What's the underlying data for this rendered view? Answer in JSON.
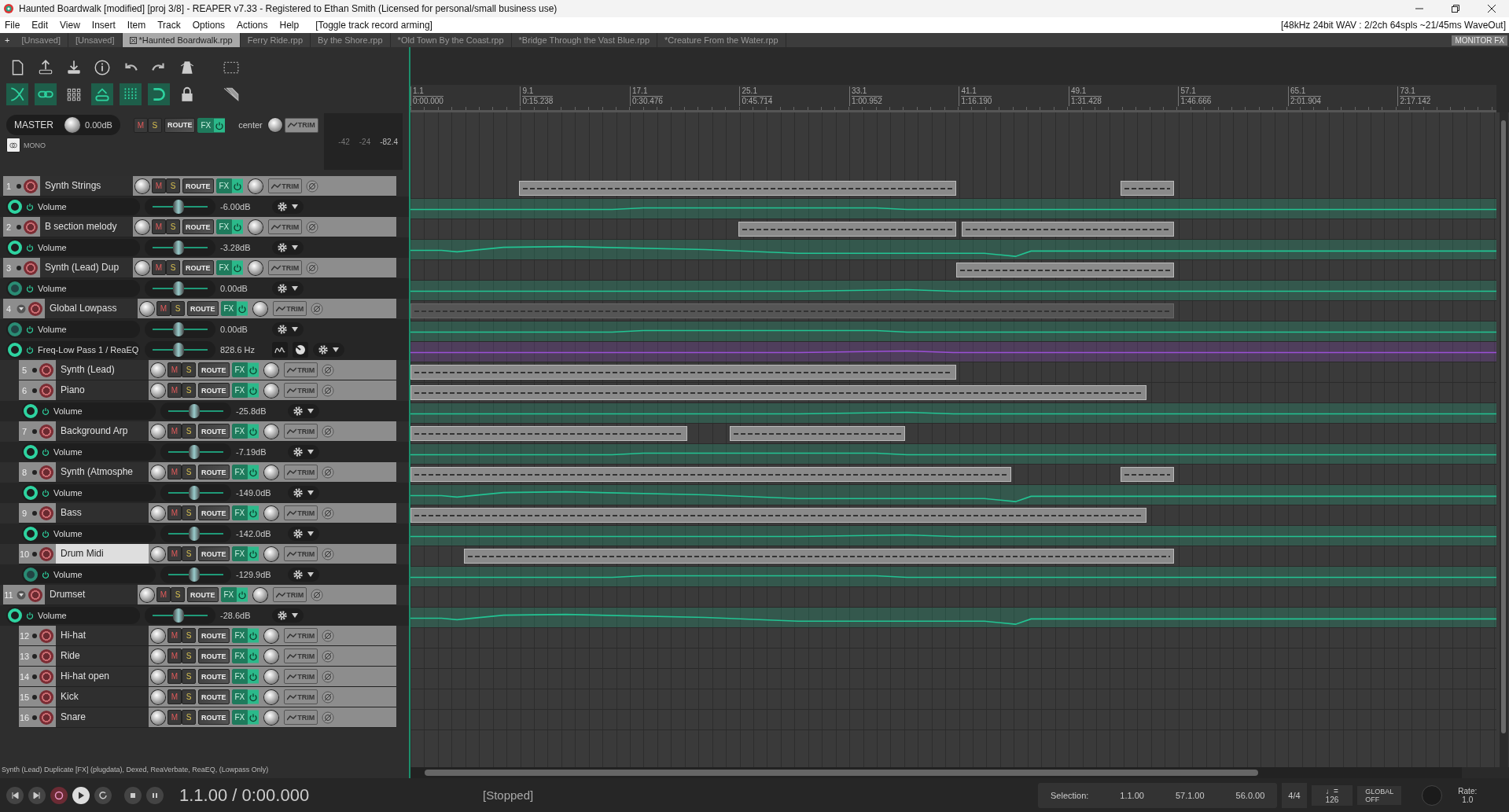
{
  "window": {
    "title": "Haunted Boardwalk [modified] [proj 3/8] - REAPER v7.33 - Registered to Ethan Smith (Licensed for personal/small business use)"
  },
  "menu": [
    "File",
    "Edit",
    "View",
    "Insert",
    "Item",
    "Track",
    "Options",
    "Actions",
    "Help"
  ],
  "menu_hint": "[Toggle track record arming]",
  "audio_status": "[48kHz 24bit WAV : 2/2ch 64spls ~21/45ms WaveOut]",
  "new_tab": "+",
  "project_tabs": [
    {
      "label": "[Unsaved]",
      "selected": false
    },
    {
      "label": "[Unsaved]",
      "selected": false
    },
    {
      "label": "*Haunted Boardwalk.rpp",
      "selected": true
    },
    {
      "label": "Ferry Ride.rpp",
      "selected": false
    },
    {
      "label": "By the Shore.rpp",
      "selected": false
    },
    {
      "label": "*Old  Town By the Coast.rpp",
      "selected": false
    },
    {
      "label": "*Bridge Through the Vast Blue.rpp",
      "selected": false
    },
    {
      "label": "*Creature From the Water.rpp",
      "selected": false
    }
  ],
  "monitor_fx": "MONITOR FX",
  "master": {
    "label": "MASTER",
    "volume": "0.00dB",
    "mute": "M",
    "solo": "S",
    "route": "ROUTE",
    "fx": "FX",
    "pan": "center",
    "trim": "TRIM",
    "mono": "MONO",
    "meter_ticks": [
      "-42",
      "-24"
    ],
    "peak": "-82.4"
  },
  "ruler": [
    {
      "bar": "1.1",
      "time": "0:00.000"
    },
    {
      "bar": "9.1",
      "time": "0:15.238"
    },
    {
      "bar": "17.1",
      "time": "0:30.476"
    },
    {
      "bar": "25.1",
      "time": "0:45.714"
    },
    {
      "bar": "33.1",
      "time": "1:00.952"
    },
    {
      "bar": "41.1",
      "time": "1:16.190"
    },
    {
      "bar": "49.1",
      "time": "1:31.428"
    },
    {
      "bar": "57.1",
      "time": "1:46.666"
    },
    {
      "bar": "65.1",
      "time": "2:01.904"
    },
    {
      "bar": "73.1",
      "time": "2:17.142"
    }
  ],
  "tracks": [
    {
      "number": "1",
      "name": "Synth Strings",
      "selected": false,
      "mute": "M",
      "solo": "S",
      "route": "ROUTE",
      "fx": "FX",
      "trim": "TRIM",
      "envelopes": [
        {
          "kind": "volume",
          "name": "Volume",
          "value": "-6.00dB",
          "armed": true,
          "color": "#22c493"
        }
      ]
    },
    {
      "number": "2",
      "name": "B section melody",
      "selected": false,
      "mute": "M",
      "solo": "S",
      "route": "ROUTE",
      "fx": "FX",
      "trim": "TRIM",
      "envelopes": [
        {
          "kind": "volume",
          "name": "Volume",
          "value": "-3.28dB",
          "armed": true,
          "color": "#22c493"
        }
      ]
    },
    {
      "number": "3",
      "name": "Synth (Lead) Dup",
      "selected": false,
      "mute": "M",
      "solo": "S",
      "route": "ROUTE",
      "fx": "FX",
      "trim": "TRIM",
      "envelopes": [
        {
          "kind": "volume",
          "name": "Volume",
          "value": "0.00dB",
          "armed": false,
          "color": "#22c493"
        }
      ]
    },
    {
      "number": "4",
      "name": "Global Lowpass",
      "selected": false,
      "mute": "M",
      "solo": "S",
      "route": "ROUTE",
      "fx": "FX",
      "trim": "TRIM",
      "envelopes": [
        {
          "kind": "volume",
          "name": "Volume",
          "value": "0.00dB",
          "armed": false,
          "color": "#22c493"
        },
        {
          "kind": "fx",
          "name": "Freq-Low Pass 1 / ReaEQ",
          "value": "828.6 Hz",
          "armed": true,
          "color": "#9b4fd6"
        }
      ],
      "children": [
        {
          "number": "5",
          "name": "Synth (Lead)",
          "selected": false,
          "mute": "M",
          "solo": "S",
          "route": "ROUTE",
          "fx": "FX",
          "trim": "TRIM"
        },
        {
          "number": "6",
          "name": "Piano",
          "selected": false,
          "mute": "M",
          "solo": "S",
          "route": "ROUTE",
          "fx": "FX",
          "trim": "TRIM",
          "envelopes": [
            {
              "kind": "volume",
              "name": "Volume",
              "value": "-25.8dB",
              "armed": true,
              "color": "#22c493"
            }
          ]
        },
        {
          "number": "7",
          "name": "Background Arp",
          "selected": false,
          "mute": "M",
          "solo": "S",
          "route": "ROUTE",
          "fx": "FX",
          "trim": "TRIM",
          "envelopes": [
            {
              "kind": "volume",
              "name": "Volume",
              "value": "-7.19dB",
              "armed": true,
              "color": "#22c493"
            }
          ]
        },
        {
          "number": "8",
          "name": "Synth (Atmosphe",
          "selected": false,
          "mute": "M",
          "solo": "S",
          "route": "ROUTE",
          "fx": "FX",
          "trim": "TRIM",
          "envelopes": [
            {
              "kind": "volume",
              "name": "Volume",
              "value": "-149.0dB",
              "armed": true,
              "color": "#22c493"
            }
          ]
        },
        {
          "number": "9",
          "name": "Bass",
          "selected": false,
          "mute": "M",
          "solo": "S",
          "route": "ROUTE",
          "fx": "FX",
          "trim": "TRIM",
          "envelopes": [
            {
              "kind": "volume",
              "name": "Volume",
              "value": "-142.0dB",
              "armed": true,
              "color": "#22c493"
            }
          ]
        },
        {
          "number": "10",
          "name": "Drum Midi",
          "selected": true,
          "mute": "M",
          "solo": "S",
          "route": "ROUTE",
          "fx": "FX",
          "trim": "TRIM",
          "envelopes": [
            {
              "kind": "volume",
              "name": "Volume",
              "value": "-129.9dB",
              "armed": false,
              "color": "#22c493"
            }
          ]
        }
      ]
    },
    {
      "number": "11",
      "name": "Drumset",
      "selected": false,
      "mute": "M",
      "solo": "S",
      "route": "ROUTE",
      "fx": "FX",
      "trim": "TRIM",
      "envelopes": [
        {
          "kind": "volume",
          "name": "Volume",
          "value": "-28.6dB",
          "armed": true,
          "color": "#22c493"
        }
      ],
      "children": [
        {
          "number": "12",
          "name": "Hi-hat",
          "selected": false,
          "mute": "M",
          "solo": "S",
          "route": "ROUTE",
          "fx": "FX",
          "trim": "TRIM"
        },
        {
          "number": "13",
          "name": "Ride",
          "selected": false,
          "mute": "M",
          "solo": "S",
          "route": "ROUTE",
          "fx": "FX",
          "trim": "TRIM"
        },
        {
          "number": "14",
          "name": "Hi-hat open",
          "selected": false,
          "mute": "M",
          "solo": "S",
          "route": "ROUTE",
          "fx": "FX",
          "trim": "TRIM"
        },
        {
          "number": "15",
          "name": "Kick",
          "selected": false,
          "mute": "M",
          "solo": "S",
          "route": "ROUTE",
          "fx": "FX",
          "trim": "TRIM"
        },
        {
          "number": "16",
          "name": "Snare",
          "selected": false,
          "mute": "M",
          "solo": "S",
          "route": "ROUTE",
          "fx": "FX",
          "trim": "TRIM"
        }
      ]
    }
  ],
  "status_line": "Synth (Lead) Duplicate [FX] (plugdata), Dexed, ReaVerbate, ReaEQ, (Lowpass Only)",
  "transport": {
    "time": "1.1.00 / 0:00.000",
    "state": "[Stopped]",
    "selection_label": "Selection:",
    "selection_start": "1.1.00",
    "selection_end": "57.1.00",
    "selection_length": "56.0.00",
    "time_signature": "4/4",
    "tempo_note": "♩=",
    "tempo": "126",
    "global_label": "GLOBAL",
    "global_value": "OFF",
    "rate_label": "Rate:",
    "rate": "1.0"
  }
}
